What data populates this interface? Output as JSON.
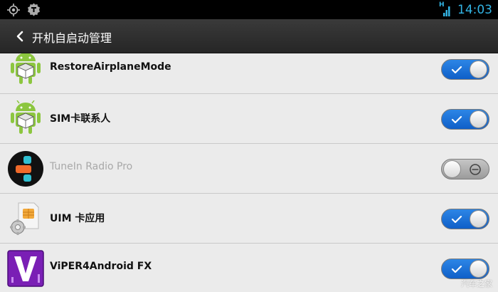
{
  "status_bar": {
    "time": "14:03",
    "network_type": "H",
    "left_icons": [
      "gps-icon",
      "app-notification-icon"
    ],
    "accent_color": "#33b5e5"
  },
  "action_bar": {
    "back_icon": "chevron-left-icon",
    "title": "开机自启动管理"
  },
  "apps": [
    {
      "name": "RestoreAirplaneMode",
      "icon": "android-robot-icon",
      "enabled": true
    },
    {
      "name": "SIM卡联系人",
      "icon": "android-robot-icon",
      "enabled": true
    },
    {
      "name": "TuneIn Radio Pro",
      "icon": "tunein-icon",
      "enabled": false
    },
    {
      "name": "UIM 卡应用",
      "icon": "sim-card-gear-icon",
      "enabled": true
    },
    {
      "name": "ViPER4Android FX",
      "icon": "viper-icon",
      "enabled": true
    }
  ],
  "colors": {
    "toggle_on": "#1e73d8",
    "toggle_off": "#b0b0b0"
  },
  "watermark": "汽车之家"
}
